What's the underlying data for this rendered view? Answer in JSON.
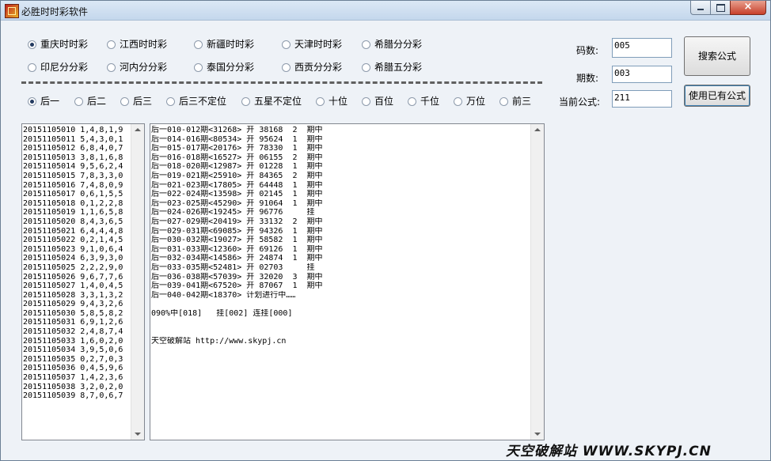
{
  "window": {
    "title": "必胜时时彩软件",
    "icon": "app-icon",
    "controls": {
      "minimize": "minimize-icon",
      "maximize": "maximize-icon",
      "close": "×"
    }
  },
  "lottery_options": [
    {
      "label": "重庆时时彩",
      "checked": true
    },
    {
      "label": "江西时时彩",
      "checked": false
    },
    {
      "label": "新疆时时彩",
      "checked": false
    },
    {
      "label": "天津时时彩",
      "checked": false
    },
    {
      "label": "希腊分分彩",
      "checked": false
    },
    {
      "label": "印尼分分彩",
      "checked": false
    },
    {
      "label": "河内分分彩",
      "checked": false
    },
    {
      "label": "泰国分分彩",
      "checked": false
    },
    {
      "label": "西贡分分彩",
      "checked": false
    },
    {
      "label": "希腊五分彩",
      "checked": false
    }
  ],
  "position_options": [
    {
      "label": "后一",
      "checked": true
    },
    {
      "label": "后二",
      "checked": false
    },
    {
      "label": "后三",
      "checked": false
    },
    {
      "label": "后三不定位",
      "checked": false
    },
    {
      "label": "五星不定位",
      "checked": false
    },
    {
      "label": "十位",
      "checked": false
    },
    {
      "label": "百位",
      "checked": false
    },
    {
      "label": "千位",
      "checked": false
    },
    {
      "label": "万位",
      "checked": false
    },
    {
      "label": "前三",
      "checked": false
    }
  ],
  "fields": {
    "code_count": {
      "label": "码数:",
      "value": "005"
    },
    "period_count": {
      "label": "期数:",
      "value": "003"
    },
    "current_formula": {
      "label": "当前公式:",
      "value": "211"
    }
  },
  "buttons": {
    "search_formula": "搜索公式",
    "use_existing_formula": "使用已有公式"
  },
  "history_list": [
    "20151105010 1,4,8,1,9",
    "20151105011 5,4,3,0,1",
    "20151105012 6,8,4,0,7",
    "20151105013 3,8,1,6,8",
    "20151105014 9,5,6,2,4",
    "20151105015 7,8,3,3,0",
    "20151105016 7,4,8,0,9",
    "20151105017 0,6,1,5,5",
    "20151105018 0,1,2,2,8",
    "20151105019 1,1,6,5,8",
    "20151105020 8,4,3,6,5",
    "20151105021 6,4,4,4,8",
    "20151105022 0,2,1,4,5",
    "20151105023 9,1,0,6,4",
    "20151105024 6,3,9,3,0",
    "20151105025 2,2,2,9,0",
    "20151105026 9,6,7,7,6",
    "20151105027 1,4,0,4,5",
    "20151105028 3,3,1,3,2",
    "20151105029 9,4,3,2,6",
    "20151105030 5,8,5,8,2",
    "20151105031 6,9,1,2,6",
    "20151105032 2,4,8,7,4",
    "20151105033 1,6,0,2,0",
    "20151105034 3,9,5,0,6",
    "20151105035 0,2,7,0,3",
    "20151105036 0,4,5,9,6",
    "20151105037 1,4,2,3,6",
    "20151105038 3,2,0,2,0",
    "20151105039 8,7,0,6,7"
  ],
  "result_list": [
    "后一010-012期<31268> 开 38168  2  期中",
    "后一014-016期<80534> 开 95624  1  期中",
    "后一015-017期<20176> 开 78330  1  期中",
    "后一016-018期<16527> 开 06155  2  期中",
    "后一018-020期<12987> 开 01228  1  期中",
    "后一019-021期<25910> 开 84365  2  期中",
    "后一021-023期<17805> 开 64448  1  期中",
    "后一022-024期<13598> 开 02145  1  期中",
    "后一023-025期<45290> 开 91064  1  期中",
    "后一024-026期<19245> 开 96776     挂",
    "后一027-029期<20419> 开 33132  2  期中",
    "后一029-031期<69085> 开 94326  1  期中",
    "后一030-032期<19027> 开 58582  1  期中",
    "后一031-033期<12360> 开 69126  1  期中",
    "后一032-034期<14586> 开 24874  1  期中",
    "后一033-035期<52481> 开 02703     挂",
    "后一036-038期<57039> 开 32020  3  期中",
    "后一039-041期<67520> 开 87067  1  期中",
    "后一040-042期<18370> 计划进行中……",
    "",
    "090%中[018]   挂[002] 连挂[000]",
    "",
    "",
    "天空破解站 http://www.skypj.cn"
  ],
  "watermark": "天空破解站 WWW.SKYPJ.CN"
}
